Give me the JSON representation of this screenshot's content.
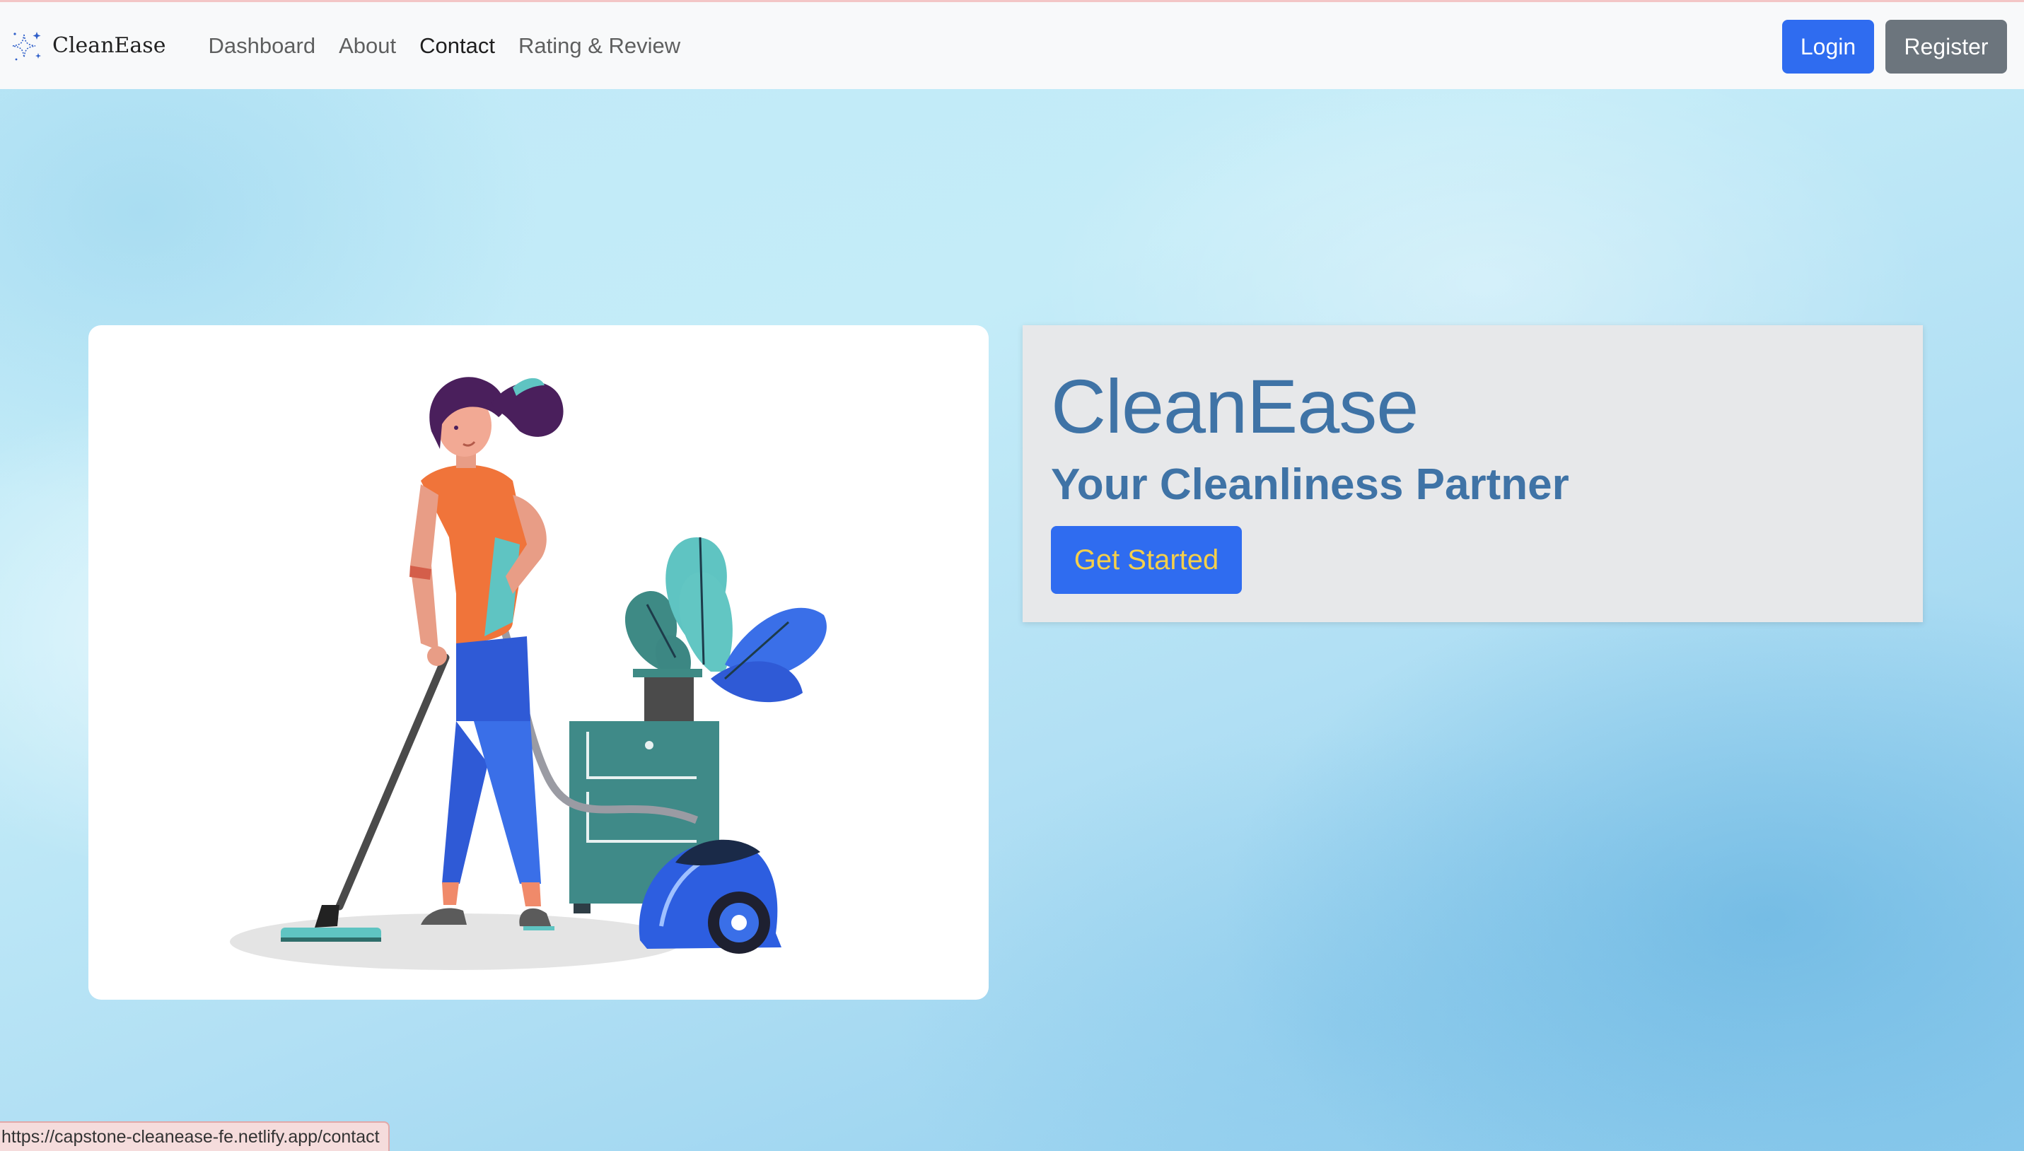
{
  "navbar": {
    "brand_text": "CleanEase",
    "brand_icon": "sparkles-icon",
    "links": [
      {
        "label": "Dashboard"
      },
      {
        "label": "About"
      },
      {
        "label": "Contact"
      },
      {
        "label": "Rating & Review"
      }
    ],
    "active_link": "Contact",
    "login_label": "Login",
    "register_label": "Register"
  },
  "hero": {
    "illustration": "woman-vacuuming-illustration",
    "title": "CleanEase",
    "subtitle": "Your Cleanliness Partner",
    "cta_label": "Get Started"
  },
  "status_bar": {
    "url": "https://capstone-cleanease-fe.netlify.app/contact"
  },
  "colors": {
    "primary": "#2f6cf0",
    "secondary": "#6c757d",
    "heading": "#3f73a6",
    "cta_text": "#f5cf4a",
    "navbar_bg": "#f8f9fa",
    "hero_card_bg": "#e7e8ea"
  }
}
